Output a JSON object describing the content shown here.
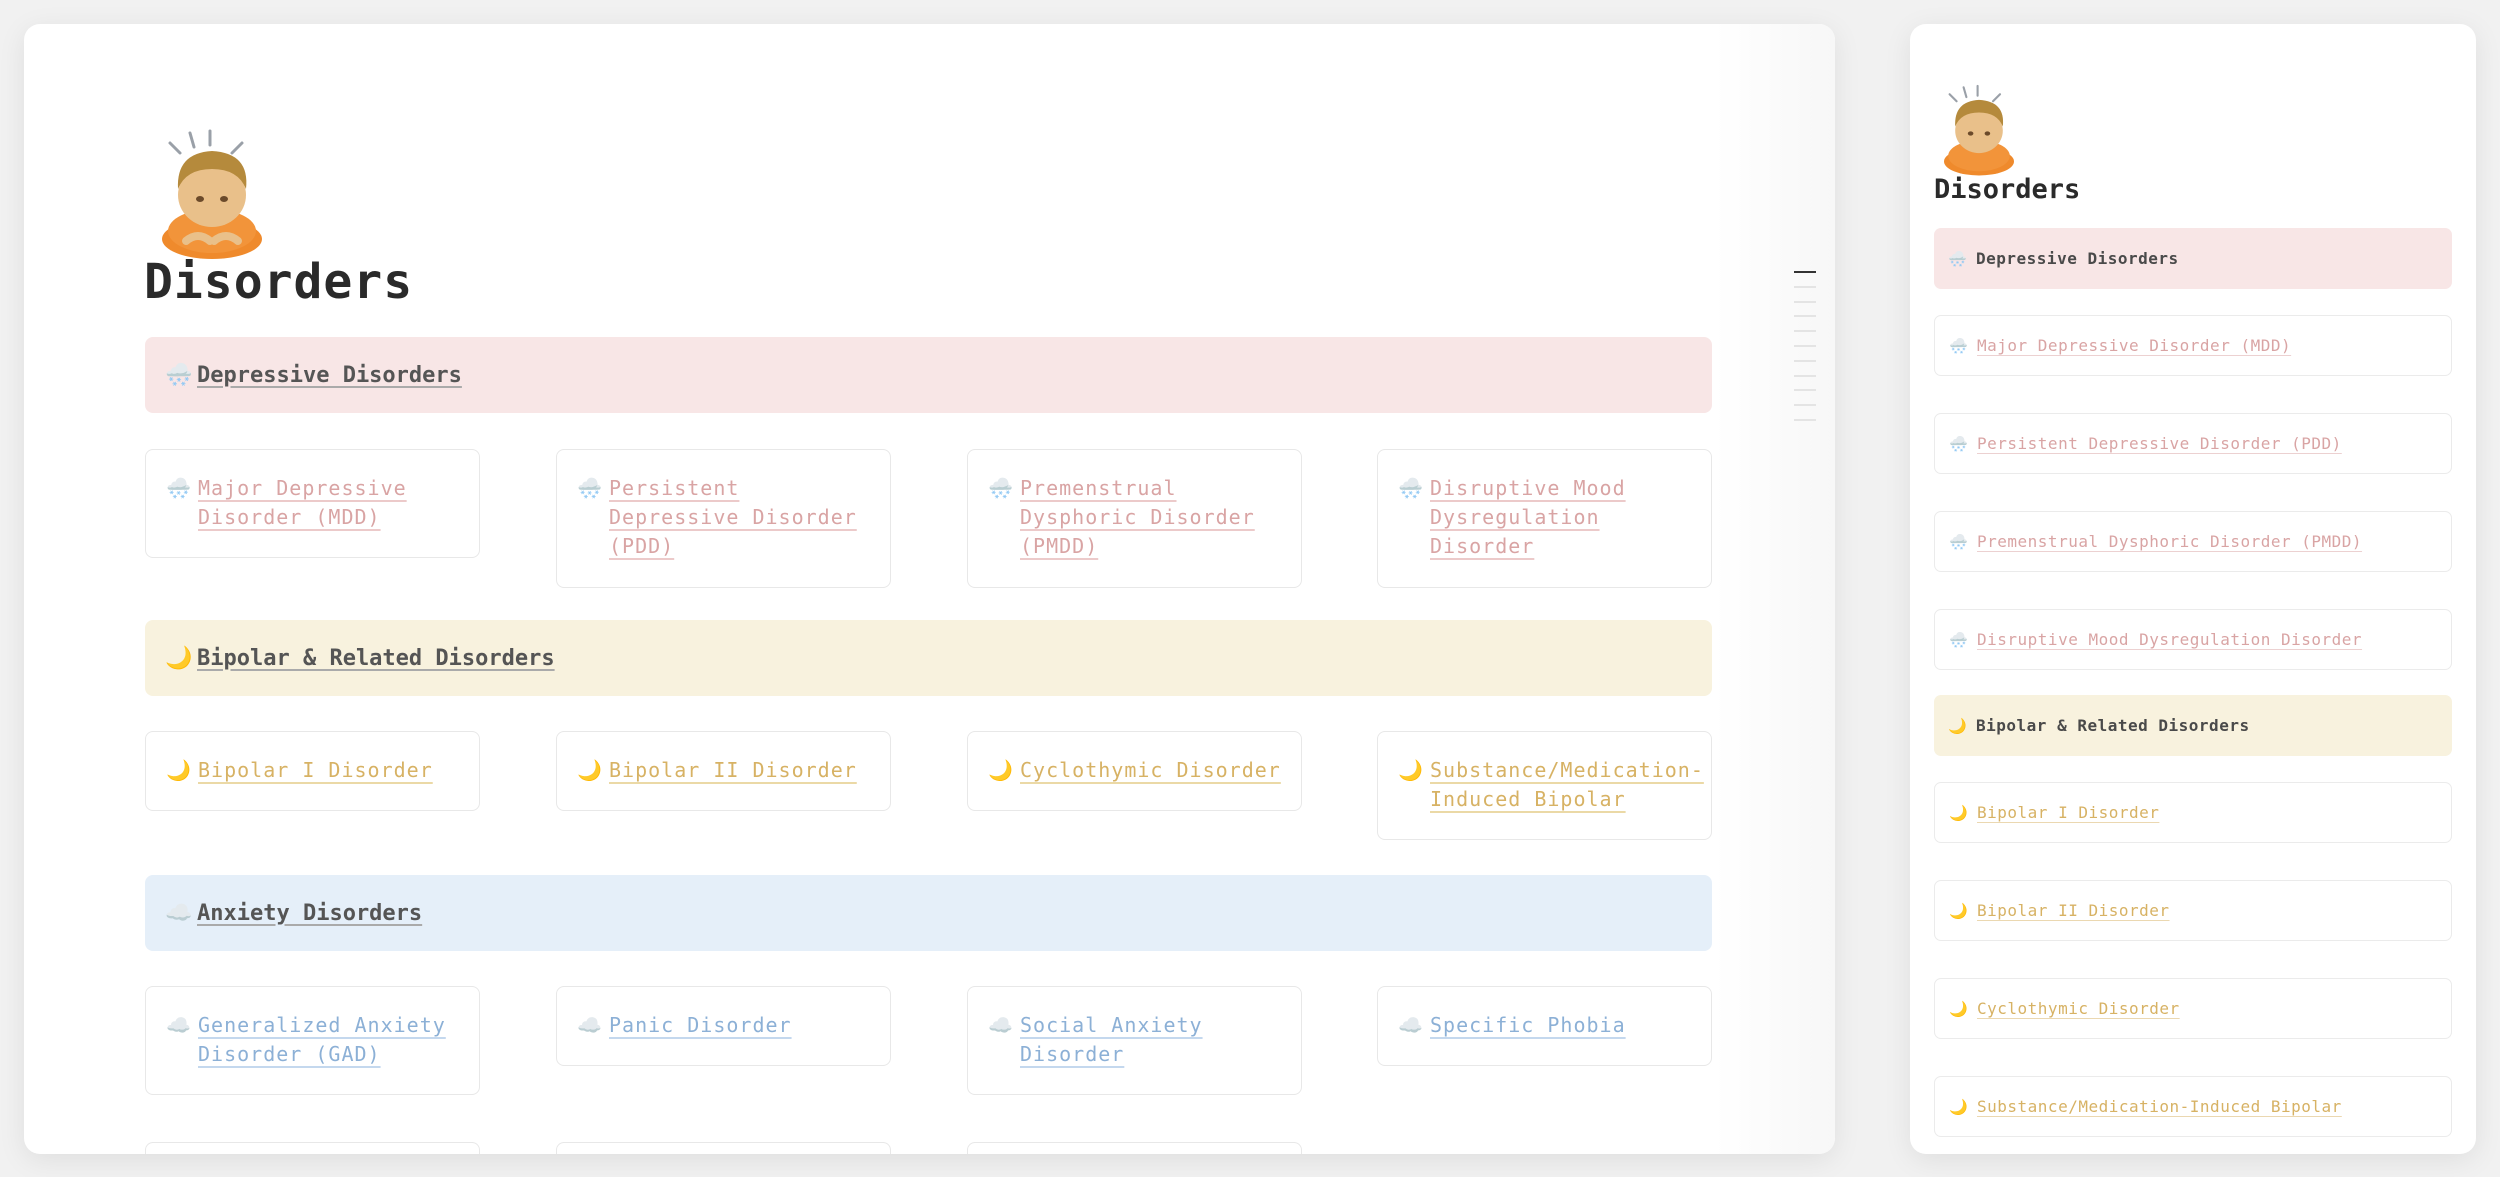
{
  "main": {
    "title": "Disorders",
    "page_icon": "person-bowing-emoji-icon",
    "sections": [
      {
        "header": {
          "glyph": "🌨️",
          "icon": "snow-cloud-icon",
          "label": "Depressive Disorders",
          "bg": "#f8e6e6"
        },
        "color_class": "pink",
        "items": [
          {
            "glyph": "🌨️",
            "icon": "snow-cloud-icon",
            "label": "Major Depressive Disorder (MDD)"
          },
          {
            "glyph": "🌨️",
            "icon": "snow-cloud-icon",
            "label": "Persistent Depressive Disorder (PDD)"
          },
          {
            "glyph": "🌨️",
            "icon": "snow-cloud-icon",
            "label": "Premenstrual Dysphoric Disorder (PMDD)"
          },
          {
            "glyph": "🌨️",
            "icon": "snow-cloud-icon",
            "label": "Disruptive Mood Dysregulation Disorder"
          }
        ]
      },
      {
        "header": {
          "glyph": "🌙",
          "icon": "crescent-moon-icon",
          "label": "Bipolar & Related Disorders",
          "bg": "#f8f2de"
        },
        "color_class": "gold",
        "items": [
          {
            "glyph": "🌙",
            "icon": "crescent-moon-icon",
            "label": "Bipolar I Disorder"
          },
          {
            "glyph": "🌙",
            "icon": "crescent-moon-icon",
            "label": "Bipolar II Disorder"
          },
          {
            "glyph": "🌙",
            "icon": "crescent-moon-icon",
            "label": "Cyclothymic Disorder"
          },
          {
            "glyph": "🌙",
            "icon": "crescent-moon-icon",
            "label": "Substance/Medication-Induced Bipolar"
          }
        ]
      },
      {
        "header": {
          "glyph": "☁️",
          "icon": "cloud-icon",
          "label": "Anxiety Disorders",
          "bg": "#e5eff9"
        },
        "color_class": "blue",
        "items": [
          {
            "glyph": "☁️",
            "icon": "cloud-icon",
            "label": "Generalized Anxiety Disorder (GAD)"
          },
          {
            "glyph": "☁️",
            "icon": "cloud-icon",
            "label": "Panic Disorder"
          },
          {
            "glyph": "☁️",
            "icon": "cloud-icon",
            "label": "Social Anxiety Disorder"
          },
          {
            "glyph": "☁️",
            "icon": "cloud-icon",
            "label": "Specific Phobia"
          }
        ]
      }
    ]
  },
  "side": {
    "title": "Disorders",
    "page_icon": "person-bowing-emoji-icon",
    "rows": [
      {
        "type": "header",
        "glyph": "🌨️",
        "icon": "snow-cloud-icon",
        "label": "Depressive Disorders",
        "bg": "#f8e6e6"
      },
      {
        "type": "item",
        "glyph": "🌨️",
        "icon": "snow-cloud-icon",
        "label": "Major Depressive Disorder (MDD)",
        "color": "#d9a4a4"
      },
      {
        "type": "item",
        "glyph": "🌨️",
        "icon": "snow-cloud-icon",
        "label": "Persistent Depressive Disorder (PDD)",
        "color": "#d9a4a4"
      },
      {
        "type": "item",
        "glyph": "🌨️",
        "icon": "snow-cloud-icon",
        "label": "Premenstrual Dysphoric Disorder (PMDD)",
        "color": "#d9a4a4"
      },
      {
        "type": "item",
        "glyph": "🌨️",
        "icon": "snow-cloud-icon",
        "label": "Disruptive Mood Dysregulation Disorder",
        "color": "#d9a4a4"
      },
      {
        "type": "header",
        "glyph": "🌙",
        "icon": "crescent-moon-icon",
        "label": "Bipolar & Related Disorders",
        "bg": "#f8f2de"
      },
      {
        "type": "item",
        "glyph": "🌙",
        "icon": "crescent-moon-icon",
        "label": "Bipolar I Disorder",
        "color": "#d7b264"
      },
      {
        "type": "item",
        "glyph": "🌙",
        "icon": "crescent-moon-icon",
        "label": "Bipolar II Disorder",
        "color": "#d7b264"
      },
      {
        "type": "item",
        "glyph": "🌙",
        "icon": "crescent-moon-icon",
        "label": "Cyclothymic Disorder",
        "color": "#d7b264"
      },
      {
        "type": "item",
        "glyph": "🌙",
        "icon": "crescent-moon-icon",
        "label": "Substance/Medication-Induced Bipolar",
        "color": "#d7b264"
      }
    ]
  }
}
